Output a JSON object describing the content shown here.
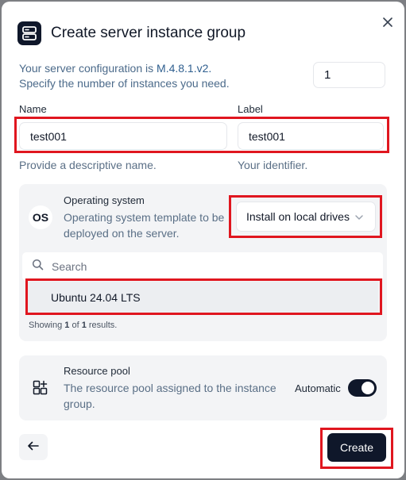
{
  "dialog": {
    "title": "Create server instance group",
    "config_line_prefix": "Your server configuration is ",
    "config_version": "M.4.8.1.v2.",
    "config_line2": "Specify the number of instances you need.",
    "instance_count": "1"
  },
  "name_field": {
    "label": "Name",
    "value": "test001",
    "hint": "Provide a descriptive name."
  },
  "label_field": {
    "label": "Label",
    "value": "test001",
    "hint": "Your identifier."
  },
  "os_section": {
    "badge": "OS",
    "title": "Operating system",
    "description": "Operating system template to be deployed on the server.",
    "install_option": "Install on local drives",
    "search_placeholder": "Search",
    "options": [
      "Ubuntu 24.04 LTS"
    ],
    "showing_prefix": "Showing ",
    "showing_count": "1",
    "showing_mid": " of ",
    "showing_total": "1",
    "showing_suffix": " results."
  },
  "resource_pool": {
    "title": "Resource pool",
    "description": "The resource pool assigned to the instance group.",
    "toggle_label": "Automatic",
    "toggle_on": true
  },
  "footer": {
    "create_label": "Create"
  },
  "icons": {
    "close": "close-icon",
    "header": "server-icon",
    "search": "search-icon",
    "chevron": "chevron-down-icon",
    "resource_pool": "grid-plus-icon",
    "back": "arrow-left-icon"
  },
  "colors": {
    "primary": "#0f172a",
    "highlight_border": "#e0161f"
  }
}
